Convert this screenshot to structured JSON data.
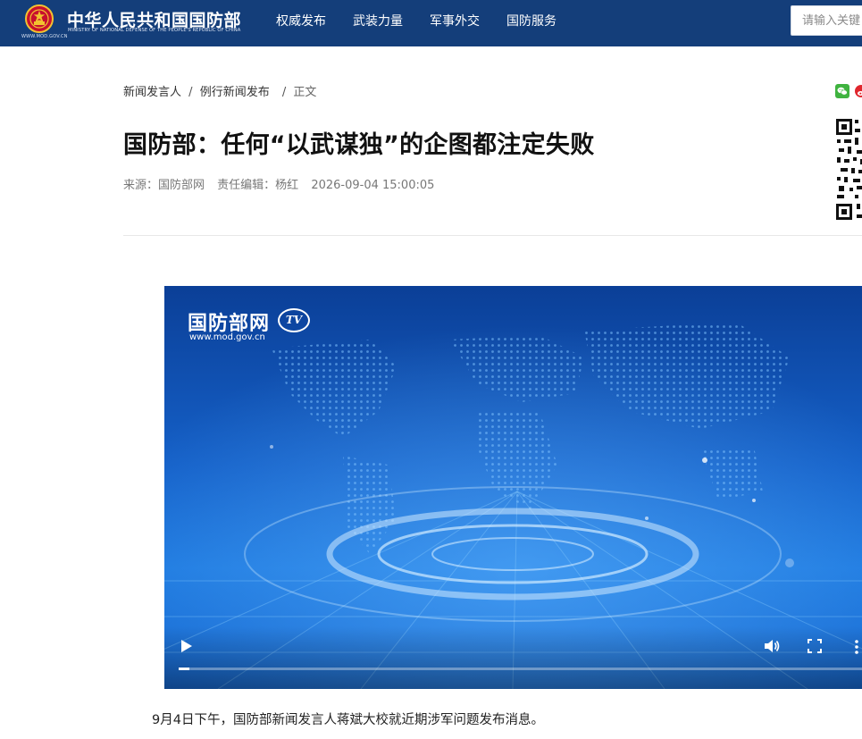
{
  "header": {
    "site_name": "中华人民共和国国防部",
    "site_name_en": "MINISTRY OF NATIONAL DEFENSE OF THE PEOPLE'S REPUBLIC OF CHINA",
    "emblem_url": "WWW.MOD.GOV.CN",
    "nav": [
      "权威发布",
      "武装力量",
      "军事外交",
      "国防服务"
    ],
    "search_placeholder": "请输入关键"
  },
  "breadcrumb": {
    "items": [
      "新闻发言人",
      "例行新闻发布"
    ],
    "separator": "/",
    "current": "正文"
  },
  "article": {
    "title": "国防部：任何“以武谋独”的企图都注定失败",
    "source": "来源：国防部网",
    "editor": "责任编辑：杨红",
    "datetime": "2026-09-04 15:00:05",
    "paragraph": "9月4日下午，国防部新闻发言人蒋斌大校就近期涉军问题发布消息。"
  },
  "video": {
    "logo_text": "国防部网",
    "logo_badge": "TV",
    "logo_url": "www.mod.gov.cn",
    "progress": 0.016
  },
  "colors": {
    "header_bg": "#143e7a",
    "video_blue": "#1561c9",
    "wechat_green": "#3fb33f",
    "weibo_red": "#e0262d"
  },
  "icons": [
    "national-emblem-icon",
    "wechat-icon",
    "weibo-icon",
    "qr-code",
    "play-icon",
    "volume-icon",
    "fullscreen-icon",
    "more-icon"
  ]
}
